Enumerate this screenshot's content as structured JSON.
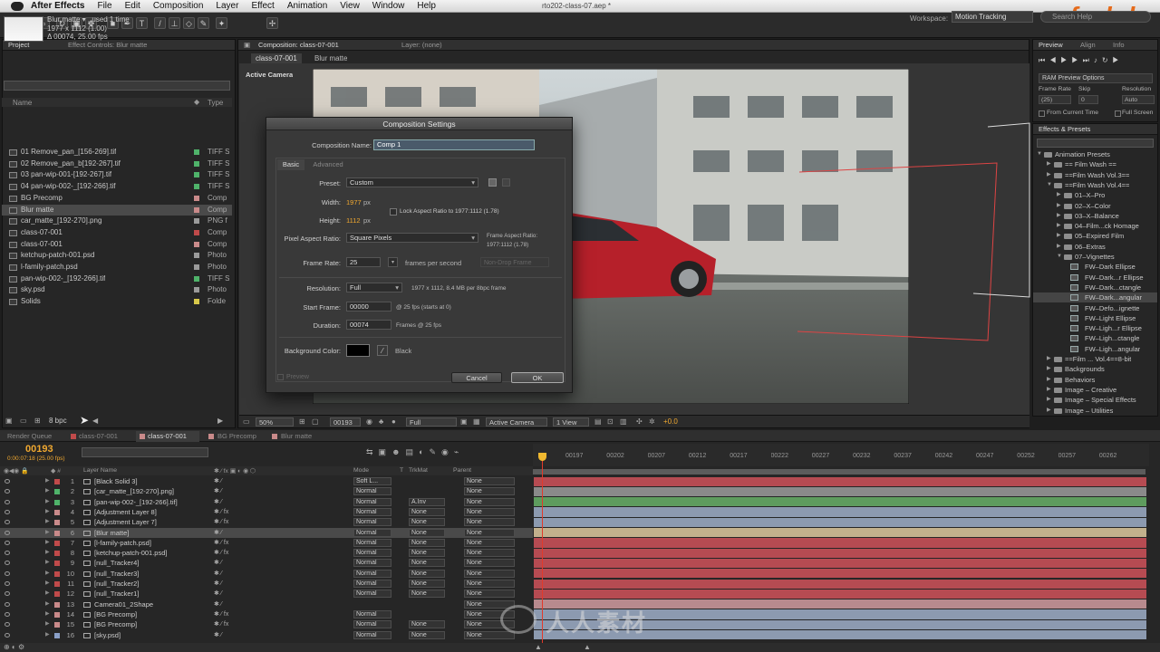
{
  "menubar": {
    "app": "After Effects",
    "items": [
      "File",
      "Edit",
      "Composition",
      "Layer",
      "Effect",
      "Animation",
      "View",
      "Window",
      "Help"
    ],
    "window_title": "rto202-class-07.aep *"
  },
  "toolbar": {
    "workspace_label": "Workspace:",
    "workspace_value": "Motion Tracking",
    "search_placeholder": "Search Help"
  },
  "brand": {
    "logo_text": "fxphd",
    "watermark": "人人素材"
  },
  "project": {
    "tab_project": "Project",
    "tab_effect_controls": "Effect Controls: Blur matte",
    "selected_name": "Blur matte ▾ , used 1 time",
    "selected_size": "1977 x 1112 (1.00)",
    "selected_duration": "Δ 00074, 25.00 fps",
    "col_name": "Name",
    "col_type": "Type",
    "items": [
      {
        "name": "01 Remove_pan_[156-269].tif",
        "type": "TIFF S",
        "color": "#4fb36a"
      },
      {
        "name": "02 Remove_pan_b[192-267].tif",
        "type": "TIFF S",
        "color": "#4fb36a"
      },
      {
        "name": "03 pan-wip-001-[192-267].tif",
        "type": "TIFF S",
        "color": "#4fb36a"
      },
      {
        "name": "04 pan-wip-002-_[192-266].tif",
        "type": "TIFF S",
        "color": "#4fb36a"
      },
      {
        "name": "BG Precomp",
        "type": "Comp",
        "color": "#c98a8a"
      },
      {
        "name": "Blur matte",
        "type": "Comp",
        "color": "#c98a8a"
      },
      {
        "name": "car_matte_[192-270].png",
        "type": "PNG f",
        "color": "#9a9a9a"
      },
      {
        "name": "class-07-001",
        "type": "Comp",
        "color": "#c04a4a"
      },
      {
        "name": "class-07-001",
        "type": "Comp",
        "color": "#c98a8a"
      },
      {
        "name": "ketchup-patch-001.psd",
        "type": "Photo",
        "color": "#9a9a9a"
      },
      {
        "name": "l-family-patch.psd",
        "type": "Photo",
        "color": "#9a9a9a"
      },
      {
        "name": "pan-wip-002-_[192-266].tif",
        "type": "TIFF S",
        "color": "#4fb36a"
      },
      {
        "name": "sky.psd",
        "type": "Photo",
        "color": "#9a9a9a"
      },
      {
        "name": "Solids",
        "type": "Folde",
        "color": "#d8c84a"
      }
    ],
    "bpc": "8 bpc"
  },
  "viewer": {
    "tab_comp": "Composition: class-07-001",
    "tab_layer": "Layer: (none)",
    "crumb_1": "class-07-001",
    "crumb_2": "Blur matte",
    "active_camera": "Active Camera",
    "zoom": "50%",
    "frame": "00193",
    "resolution": "Full",
    "camera": "Active Camera",
    "views": "1 View",
    "exposure": "+0.0"
  },
  "dialog": {
    "title": "Composition Settings",
    "comp_name_label": "Composition Name:",
    "comp_name": "Comp 1",
    "tab_basic": "Basic",
    "tab_advanced": "Advanced",
    "preset_label": "Preset:",
    "preset": "Custom",
    "width_label": "Width:",
    "width": "1977",
    "height_label": "Height:",
    "height": "1112",
    "px": "px",
    "lock_label": "Lock Aspect Ratio to 1977:1112 (1.78)",
    "par_label": "Pixel Aspect Ratio:",
    "par": "Square Pixels",
    "frame_aspect_label": "Frame Aspect Ratio:",
    "frame_aspect": "1977:1112 (1.78)",
    "frame_rate_label": "Frame Rate:",
    "frame_rate": "25",
    "fps_label": "frames per second",
    "drop_frame": "Non-Drop Frame",
    "resolution_label": "Resolution:",
    "resolution": "Full",
    "resolution_info": "1977 x 1112, 8.4 MB per 8bpc frame",
    "start_label": "Start Frame:",
    "start": "00000",
    "start_info": "@ 25 fps (starts at 0)",
    "duration_label": "Duration:",
    "duration": "00074",
    "duration_info": "Frames @ 25 fps",
    "bg_label": "Background Color:",
    "bg_name": "Black",
    "preview": "Preview",
    "cancel": "Cancel",
    "ok": "OK"
  },
  "preview_panel": {
    "tab_preview": "Preview",
    "tab_align": "Align",
    "tab_info": "Info",
    "ram_options": "RAM Preview Options",
    "frame_rate_label": "Frame Rate",
    "skip_label": "Skip",
    "resolution_label": "Resolution",
    "frame_rate": "(25)",
    "skip": "0",
    "resolution": "Auto",
    "from_current": "From Current Time",
    "full_screen": "Full Screen"
  },
  "effects_panel": {
    "title": "Effects & Presets",
    "items": [
      {
        "depth": 0,
        "open": true,
        "kind": "folder",
        "name": "Animation Presets"
      },
      {
        "depth": 1,
        "open": false,
        "kind": "folder",
        "name": "== Film Wash =="
      },
      {
        "depth": 1,
        "open": false,
        "kind": "folder",
        "name": "==Film Wash Vol.3=="
      },
      {
        "depth": 1,
        "open": true,
        "kind": "folder",
        "name": "==Film Wash Vol.4=="
      },
      {
        "depth": 2,
        "open": false,
        "kind": "folder",
        "name": "01–X–Pro"
      },
      {
        "depth": 2,
        "open": false,
        "kind": "folder",
        "name": "02–X–Color"
      },
      {
        "depth": 2,
        "open": false,
        "kind": "folder",
        "name": "03–X–Balance"
      },
      {
        "depth": 2,
        "open": false,
        "kind": "folder",
        "name": "04–Film...ck Homage"
      },
      {
        "depth": 2,
        "open": false,
        "kind": "folder",
        "name": "05–Expired Film"
      },
      {
        "depth": 2,
        "open": false,
        "kind": "folder",
        "name": "06–Extras"
      },
      {
        "depth": 2,
        "open": true,
        "kind": "folder",
        "name": "07–Vignettes"
      },
      {
        "depth": 3,
        "kind": "preset",
        "name": "FW–Dark Ellipse"
      },
      {
        "depth": 3,
        "kind": "preset",
        "name": "FW–Dark...r Ellipse"
      },
      {
        "depth": 3,
        "kind": "preset",
        "name": "FW–Dark...ctangle"
      },
      {
        "depth": 3,
        "kind": "preset",
        "name": "FW–Dark...angular",
        "sel": true
      },
      {
        "depth": 3,
        "kind": "preset",
        "name": "FW–Defo...ignette"
      },
      {
        "depth": 3,
        "kind": "preset",
        "name": "FW–Light Ellipse"
      },
      {
        "depth": 3,
        "kind": "preset",
        "name": "FW–Ligh...r Ellipse"
      },
      {
        "depth": 3,
        "kind": "preset",
        "name": "FW–Ligh...ctangle"
      },
      {
        "depth": 3,
        "kind": "preset",
        "name": "FW–Ligh...angular"
      },
      {
        "depth": 1,
        "open": false,
        "kind": "folder",
        "name": "==Film ... Vol.4==8-bit"
      },
      {
        "depth": 1,
        "open": false,
        "kind": "folder",
        "name": "Backgrounds"
      },
      {
        "depth": 1,
        "open": false,
        "kind": "folder",
        "name": "Behaviors"
      },
      {
        "depth": 1,
        "open": false,
        "kind": "folder",
        "name": "Image – Creative"
      },
      {
        "depth": 1,
        "open": false,
        "kind": "folder",
        "name": "Image – Special Effects"
      },
      {
        "depth": 1,
        "open": false,
        "kind": "folder",
        "name": "Image – Utilities"
      }
    ]
  },
  "timeline": {
    "tabs": [
      "Render Queue",
      "class-07-001",
      "class-07-001",
      "BG Precomp",
      "Blur matte"
    ],
    "timecode": "00193",
    "timecode_sub": "0:00:07:18 (25.00 fps)",
    "col_layer_name": "Layer Name",
    "col_mode": "Mode",
    "col_t": "T",
    "col_trkmat": "TrkMat",
    "col_parent": "Parent",
    "ticks": [
      "00197",
      "00202",
      "00207",
      "00212",
      "00217",
      "00222",
      "00227",
      "00232",
      "00237",
      "00242",
      "00247",
      "00252",
      "00257",
      "00262"
    ],
    "layers": [
      {
        "num": "1",
        "name": "[Black Solid 3]",
        "mode": "Soft L...",
        "trk": "",
        "parent": "None",
        "color": "#c04a4a",
        "bar": "#b64b52",
        "fx": false
      },
      {
        "num": "2",
        "name": "[car_matte_[192-270].png]",
        "mode": "Normal",
        "trk": "",
        "parent": "None",
        "color": "#4fb36a",
        "bar": "#8a8a8a",
        "fx": false
      },
      {
        "num": "3",
        "name": "[pan-wip-002-_[192-266].tif]",
        "mode": "Normal",
        "trk": "A.Inv",
        "parent": "None",
        "color": "#4fb36a",
        "bar": "#5e9c5e",
        "fx": false
      },
      {
        "num": "4",
        "name": "[Adjustment Layer 8]",
        "mode": "Normal",
        "trk": "None",
        "parent": "None",
        "color": "#c98a8a",
        "bar": "#8c9ab0",
        "fx": true
      },
      {
        "num": "5",
        "name": "[Adjustment Layer 7]",
        "mode": "Normal",
        "trk": "None",
        "parent": "None",
        "color": "#c98a8a",
        "bar": "#8c9ab0",
        "fx": true
      },
      {
        "num": "6",
        "name": "[Blur matte]",
        "mode": "Normal",
        "trk": "None",
        "parent": "None",
        "color": "#c98a8a",
        "bar": "#c2b08c",
        "fx": false,
        "sel": true
      },
      {
        "num": "7",
        "name": "[l-family-patch.psd]",
        "mode": "Normal",
        "trk": "None",
        "parent": "None",
        "color": "#c04a4a",
        "bar": "#b64b52",
        "fx": true
      },
      {
        "num": "8",
        "name": "[ketchup-patch-001.psd]",
        "mode": "Normal",
        "trk": "None",
        "parent": "None",
        "color": "#c04a4a",
        "bar": "#b64b52",
        "fx": true
      },
      {
        "num": "9",
        "name": "[null_Tracker4]",
        "mode": "Normal",
        "trk": "None",
        "parent": "None",
        "color": "#c04a4a",
        "bar": "#b64b52",
        "fx": false
      },
      {
        "num": "10",
        "name": "[null_Tracker3]",
        "mode": "Normal",
        "trk": "None",
        "parent": "None",
        "color": "#c04a4a",
        "bar": "#b64b52",
        "fx": false
      },
      {
        "num": "11",
        "name": "[null_Tracker2]",
        "mode": "Normal",
        "trk": "None",
        "parent": "None",
        "color": "#c04a4a",
        "bar": "#b64b52",
        "fx": false
      },
      {
        "num": "12",
        "name": "[null_Tracker1]",
        "mode": "Normal",
        "trk": "None",
        "parent": "None",
        "color": "#c04a4a",
        "bar": "#b64b52",
        "fx": false
      },
      {
        "num": "13",
        "name": "Camera01_2Shape",
        "mode": "",
        "trk": "",
        "parent": "None",
        "color": "#c98a8a",
        "bar": "#b88a8e",
        "fx": false
      },
      {
        "num": "14",
        "name": "[BG Precomp]",
        "mode": "Normal",
        "trk": "",
        "parent": "None",
        "color": "#c98a8a",
        "bar": "#8c9ab0",
        "fx": true
      },
      {
        "num": "15",
        "name": "[BG Precomp]",
        "mode": "Normal",
        "trk": "None",
        "parent": "None",
        "color": "#c98a8a",
        "bar": "#8c9ab0",
        "fx": true
      },
      {
        "num": "16",
        "name": "[sky.psd]",
        "mode": "Normal",
        "trk": "None",
        "parent": "None",
        "color": "#8aa0c8",
        "bar": "#8c9ab0",
        "fx": false
      }
    ]
  }
}
